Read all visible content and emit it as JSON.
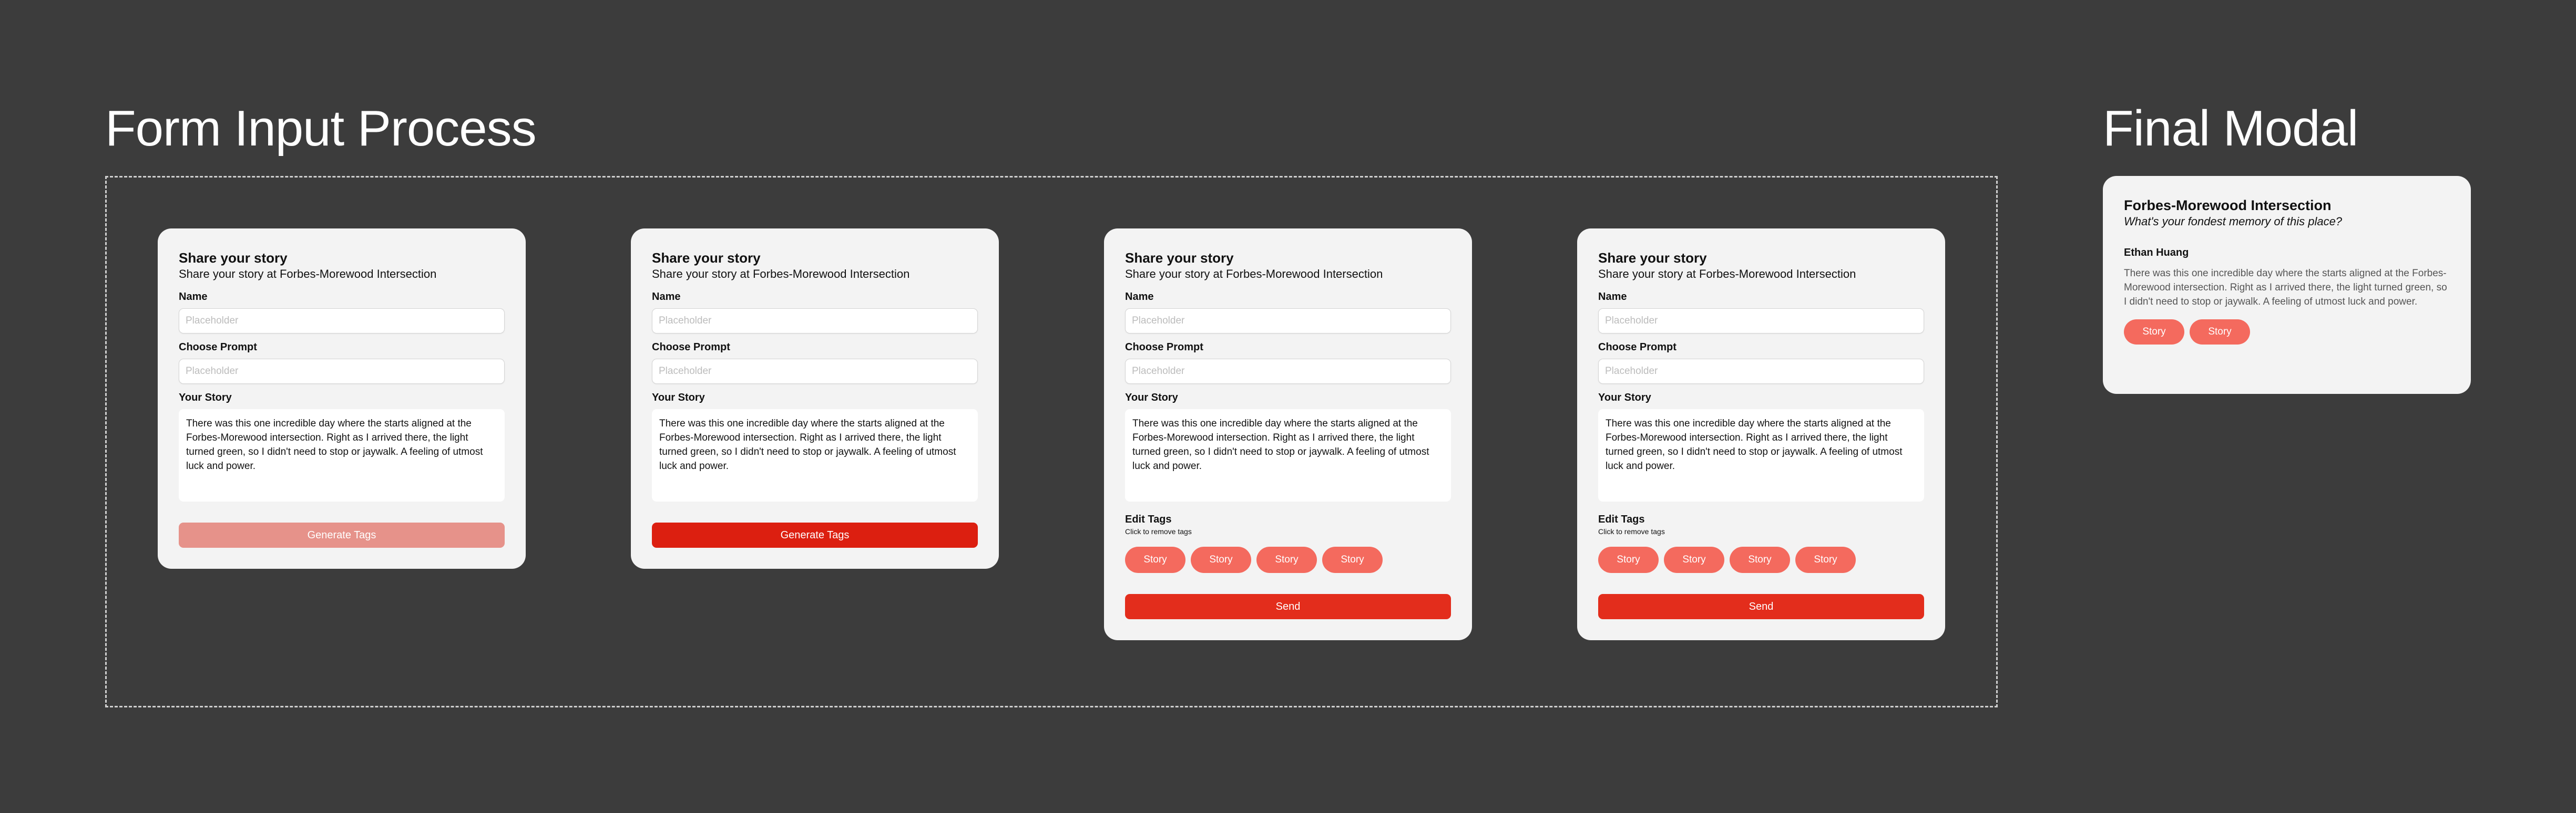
{
  "sections": {
    "process_title": "Form Input Process",
    "final_title": "Final Modal"
  },
  "form": {
    "title": "Share your story",
    "subtitle": "Share your story at Forbes-Morewood Intersection",
    "name_label": "Name",
    "name_placeholder": "Placeholder",
    "prompt_label": "Choose Prompt",
    "prompt_placeholder": "Placeholder",
    "story_label": "Your Story",
    "story_text": "There was this one incredible day where the starts aligned at the Forbes-Morewood intersection. Right as I arrived there, the light turned green, so I didn't need to stop or jaywalk. A feeling of utmost luck and power.",
    "generate_label": "Generate Tags",
    "edit_tags_label": "Edit Tags",
    "edit_tags_hint": "Click to remove tags",
    "tags": [
      "Story",
      "Story",
      "Story",
      "Story"
    ],
    "send_label": "Send"
  },
  "modal": {
    "title": "Forbes-Morewood Intersection",
    "prompt": "What's your fondest memory of this place?",
    "author": "Ethan Huang",
    "story": "There was this one incredible day where the starts aligned at the Forbes-Morewood intersection. Right as I arrived there, the light turned green, so I didn't need to stop or jaywalk. A feeling of utmost luck and power.",
    "tags": [
      "Story",
      "Story"
    ]
  },
  "colors": {
    "background": "#3c3c3c",
    "card": "#f3f3f3",
    "button_disabled": "#e6928a",
    "button_active": "#dc1f10",
    "tag": "#f46a5e"
  }
}
